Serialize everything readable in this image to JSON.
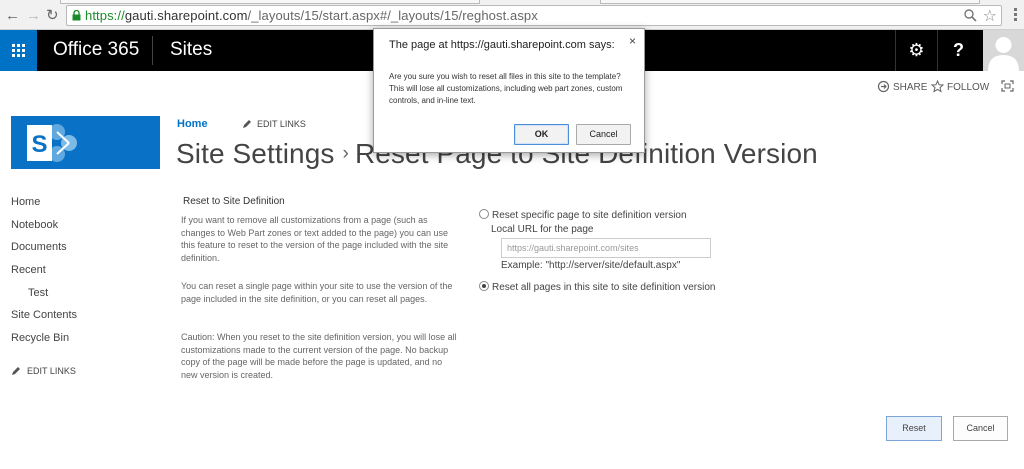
{
  "browser": {
    "url_secure": "https://",
    "url_host": "gauti.sharepoint.com",
    "url_path": "/_layouts/15/start.aspx#/_layouts/15/reghost.aspx",
    "back_icon": "back-arrow-icon",
    "forward_icon": "forward-arrow-icon"
  },
  "suitebar": {
    "brand": "Office 365",
    "app": "Sites",
    "settings_glyph": "⚙",
    "help_glyph": "?",
    "accent": "#0072c6"
  },
  "actions": {
    "share": "SHARE",
    "follow": "FOLLOW"
  },
  "breadcrumb": {
    "home": "Home",
    "edit_links": "EDIT LINKS"
  },
  "title": {
    "main": "Site Settings",
    "separator": "›",
    "sub": "Reset Page to Site Definition Version"
  },
  "left_nav": {
    "items": [
      {
        "label": "Home"
      },
      {
        "label": "Notebook"
      },
      {
        "label": "Documents"
      },
      {
        "label": "Recent"
      },
      {
        "label": "Test"
      },
      {
        "label": "Site Contents"
      },
      {
        "label": "Recycle Bin"
      }
    ],
    "edit_links": "EDIT LINKS"
  },
  "section": {
    "title": "Reset to Site Definition",
    "para1": "If you want to remove all customizations from a page (such as changes to Web Part zones or text added to the page) you can use this feature to reset to the version of the page included with the site definition.",
    "para2": "You can reset a single page within your site to use the version of the page included in the site definition, or you can reset all pages.",
    "para3": "Caution: When you reset to the site definition version, you will lose all customizations made to the current version of the page. No backup copy of the page will be made before the page is updated, and no new version is created."
  },
  "form": {
    "option_specific": "Reset specific page to site definition version",
    "local_url_label": "Local URL for the page",
    "local_url_value": "https://gauti.sharepoint.com/sites",
    "example": "Example: \"http://server/site/default.aspx\"",
    "option_all": "Reset all pages in this site to site definition version",
    "selected": "all"
  },
  "buttons": {
    "reset": "Reset",
    "cancel": "Cancel"
  },
  "dialog": {
    "title": "The page at https://gauti.sharepoint.com says:",
    "message": "Are you sure you wish to reset all files in this site to the template?  This will lose all customizations, including web part zones, custom controls, and in-line text.",
    "ok": "OK",
    "cancel": "Cancel",
    "close_glyph": "×"
  }
}
